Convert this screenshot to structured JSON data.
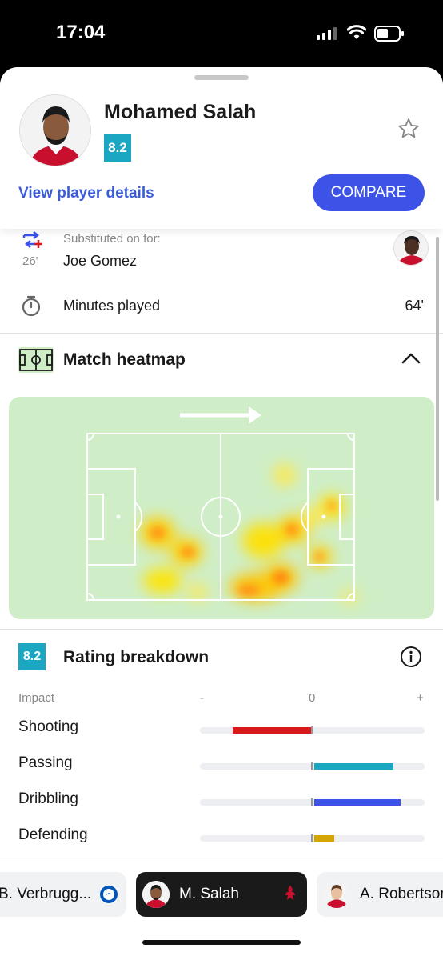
{
  "status_bar": {
    "time": "17:04"
  },
  "player": {
    "name": "Mohamed Salah",
    "rating": "8.2",
    "view_details_label": "View player details",
    "compare_label": "COMPARE"
  },
  "substitution": {
    "caption": "Substituted on for:",
    "player": "Joe Gomez",
    "minute": "26'"
  },
  "minutes_played": {
    "label": "Minutes played",
    "value": "64'"
  },
  "heatmap": {
    "title": "Match heatmap"
  },
  "rating_breakdown": {
    "badge": "8.2",
    "title": "Rating breakdown",
    "impact_label": "Impact",
    "scale_minus": "-",
    "scale_zero": "0",
    "scale_plus": "+",
    "stats": [
      {
        "label": "Shooting",
        "impact": -0.71,
        "color": "#d7191c"
      },
      {
        "label": "Passing",
        "impact": 0.71,
        "color": "#1ba6c2"
      },
      {
        "label": "Dribbling",
        "impact": 0.77,
        "color": "#3d53e8"
      },
      {
        "label": "Defending",
        "impact": 0.18,
        "color": "#d4a500"
      }
    ]
  },
  "player_switcher": [
    {
      "name": "B. Verbrugg...",
      "active": false
    },
    {
      "name": "M. Salah",
      "active": true
    },
    {
      "name": "A. Robertson",
      "active": false
    }
  ],
  "colors": {
    "accent": "#3d53e8",
    "rating": "#1ba6c2",
    "heatmap_bg": "#cfeec7"
  }
}
